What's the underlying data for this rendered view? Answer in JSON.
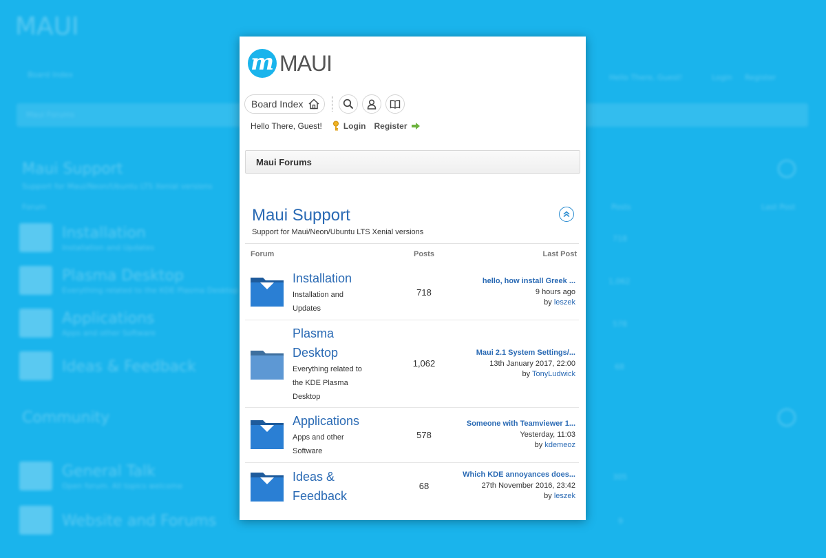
{
  "logo": {
    "letter": "m",
    "text": "MAUI"
  },
  "nav": {
    "board_index": "Board Index"
  },
  "welcome": {
    "greeting": "Hello There, Guest!",
    "login": "Login",
    "register": "Register"
  },
  "breadcrumb": {
    "label": "Maui Forums"
  },
  "category": {
    "title": "Maui Support",
    "description": "Support for Maui/Neon/Ubuntu LTS Xenial versions",
    "columns": {
      "forum": "Forum",
      "posts": "Posts",
      "last_post": "Last Post"
    }
  },
  "forums": [
    {
      "name": "Installation",
      "desc": "Installation and Updates",
      "posts": "718",
      "last_topic": "hello, how install Greek ...",
      "last_time": "9 hours ago",
      "by": "by",
      "author": "leszek"
    },
    {
      "name": "Plasma Desktop",
      "desc": "Everything related to the KDE Plasma Desktop",
      "posts": "1,062",
      "last_topic": "Maui 2.1 System Settings/...",
      "last_time": "13th January 2017, 22:00",
      "by": "by",
      "author": "TonyLudwick"
    },
    {
      "name": "Applications",
      "desc": "Apps and other Software",
      "posts": "578",
      "last_topic": "Someone with Teamviewer 1...",
      "last_time": "Yesterday, 11:03",
      "by": "by",
      "author": "kdemeoz"
    },
    {
      "name": "Ideas & Feedback",
      "desc": "",
      "posts": "68",
      "last_topic": "Which KDE annoyances does...",
      "last_time": "27th November 2016, 23:42",
      "by": "by",
      "author": "leszek"
    }
  ],
  "background": {
    "logo": "MAUI",
    "nav": "Board Index",
    "welcome": "Hello There, Guest!",
    "login": "Login",
    "register": "Register",
    "crumb": "Maui Forums",
    "cat1": "Maui Support",
    "cat1_desc": "Support for Maui/Neon/Ubuntu LTS Xenial versions",
    "forum_col": "Forum",
    "posts_col": "Posts",
    "last_col": "Last Post",
    "f1": "Installation",
    "f1d": "Installation and Updates",
    "f2": "Plasma Desktop",
    "f2d": "Everything related to the KDE Plasma Desktop",
    "f3": "Applications",
    "f3d": "Apps and other Software",
    "f4": "Ideas & Feedback",
    "cat2": "Community",
    "f5": "General Talk",
    "f5d": "Open forum. All topics welcome",
    "f6": "Website and Forums",
    "p1": "718",
    "p2": "1,062",
    "p3": "578",
    "p4": "68",
    "p5": "305",
    "p6": "9"
  },
  "colors": {
    "background": "#1ab4ec",
    "link": "#2a6ab4",
    "folder": "#2a7fd4"
  }
}
